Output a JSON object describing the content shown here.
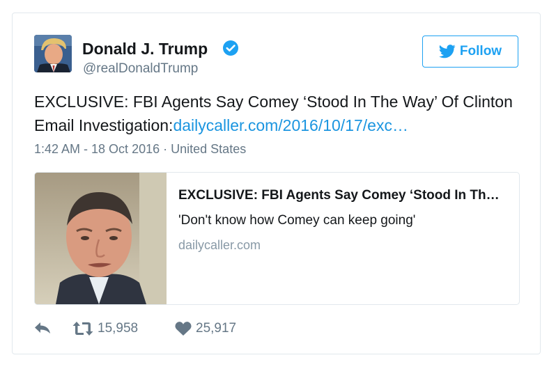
{
  "tweet": {
    "author_name": "Donald J. Trump",
    "handle": "@realDonaldTrump",
    "follow_label": "Follow",
    "text": "EXCLUSIVE: FBI Agents Say Comey ‘Stood In The Way’ Of Clinton Email Investigation:",
    "link_text": "dailycaller.com/2016/10/17/exc…",
    "timestamp": "1:42 AM - 18 Oct 2016",
    "separator": "·",
    "location": "United States",
    "card": {
      "title": "EXCLUSIVE: FBI Agents Say Comey ‘Stood In The Way’ Of Clinton Email Investigation",
      "description": "'Don't know how Comey can keep going'",
      "domain": "dailycaller.com"
    },
    "stats": {
      "retweets": "15,958",
      "likes": "25,917"
    }
  },
  "icons": [
    "verified-badge-icon",
    "twitter-bird-icon",
    "reply-icon",
    "retweet-icon",
    "heart-icon"
  ],
  "colors": {
    "accent": "#1da1f2",
    "link": "#1b95e0",
    "text": "#14171a",
    "muted": "#657786",
    "border": "#e1e8ed"
  }
}
